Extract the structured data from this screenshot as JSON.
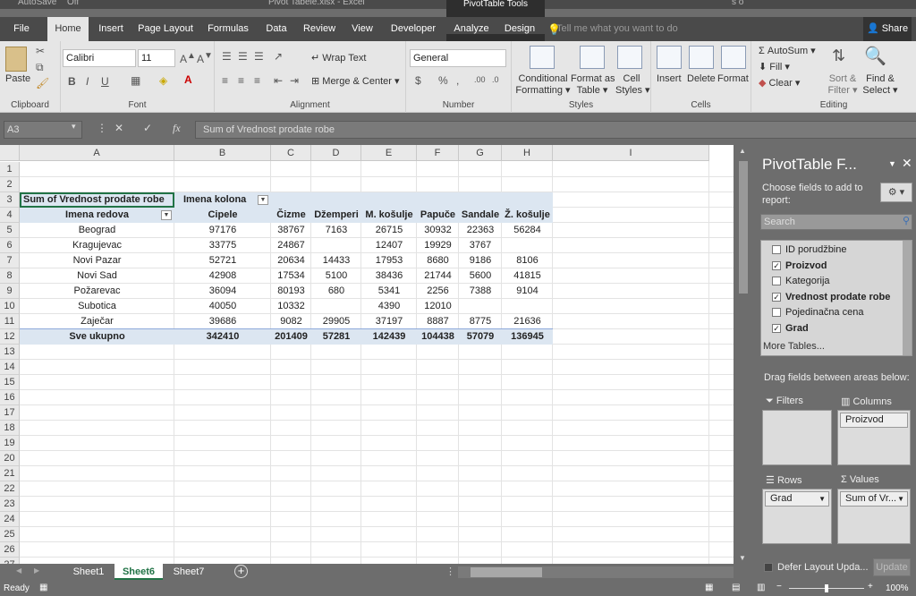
{
  "title_bar": {
    "autosave": "AutoSave",
    "autosave_state": "Off",
    "filename": "Pivot Tabele.xlsx - Excel",
    "user": "s o"
  },
  "context_header": "PivotTable Tools",
  "tabs": [
    "File",
    "Home",
    "Insert",
    "Page Layout",
    "Formulas",
    "Data",
    "Review",
    "View",
    "Developer",
    "Analyze",
    "Design"
  ],
  "active_tab": "Home",
  "tell_me": "Tell me what you want to do",
  "share": "Share",
  "ribbon": {
    "clipboard": {
      "paste": "Paste",
      "label": "Clipboard"
    },
    "font": {
      "name": "Calibri",
      "size": "11",
      "label": "Font",
      "bold": "B",
      "italic": "I",
      "underline": "U"
    },
    "alignment": {
      "wrap": "Wrap Text",
      "merge": "Merge & Center",
      "label": "Alignment"
    },
    "number": {
      "format": "General",
      "currency": "$",
      "percent": "%",
      "comma": ",",
      "label": "Number"
    },
    "styles": {
      "cond": "Conditional",
      "cond2": "Formatting",
      "fat": "Format as",
      "fat2": "Table",
      "cell": "Cell",
      "cell2": "Styles",
      "label": "Styles"
    },
    "cells": {
      "insert": "Insert",
      "delete": "Delete",
      "format": "Format",
      "label": "Cells"
    },
    "editing": {
      "autosum": "AutoSum",
      "fill": "Fill",
      "clear": "Clear",
      "sort": "Sort &",
      "sort2": "Filter",
      "find": "Find &",
      "find2": "Select",
      "label": "Editing"
    }
  },
  "formula_bar": {
    "name_box": "A3",
    "fx": "fx",
    "content": "Sum of Vrednost prodate robe"
  },
  "columns": [
    "A",
    "B",
    "C",
    "D",
    "E",
    "F",
    "G",
    "H",
    "I"
  ],
  "rows": [
    "1",
    "2",
    "3",
    "4",
    "5",
    "6",
    "7",
    "8",
    "9",
    "10",
    "11",
    "12",
    "13",
    "14",
    "15",
    "16",
    "17",
    "18",
    "19",
    "20",
    "21",
    "22",
    "23",
    "24",
    "25",
    "26",
    "27"
  ],
  "pivot": {
    "values_label": "Sum of Vrednost prodate robe",
    "col_labels": "Imena kolona",
    "row_labels": "Imena redova",
    "products": [
      "Cipele",
      "Čizme",
      "Džemperi",
      "M. košulje",
      "Papuče",
      "Sandale",
      "Ž. košulje"
    ],
    "data": [
      {
        "city": "Beograd",
        "vals": [
          "97176",
          "38767",
          "7163",
          "26715",
          "30932",
          "22363",
          "56284"
        ]
      },
      {
        "city": "Kragujevac",
        "vals": [
          "33775",
          "24867",
          "",
          "12407",
          "19929",
          "3767",
          ""
        ]
      },
      {
        "city": "Novi Pazar",
        "vals": [
          "52721",
          "20634",
          "14433",
          "17953",
          "8680",
          "9186",
          "8106"
        ]
      },
      {
        "city": "Novi Sad",
        "vals": [
          "42908",
          "17534",
          "5100",
          "38436",
          "21744",
          "5600",
          "41815"
        ]
      },
      {
        "city": "Požarevac",
        "vals": [
          "36094",
          "80193",
          "680",
          "5341",
          "2256",
          "7388",
          "9104"
        ]
      },
      {
        "city": "Subotica",
        "vals": [
          "40050",
          "10332",
          "",
          "4390",
          "12010",
          "",
          ""
        ]
      },
      {
        "city": "Zaječar",
        "vals": [
          "39686",
          "9082",
          "29905",
          "37197",
          "8887",
          "8775",
          "21636"
        ]
      }
    ],
    "total_label": "Sve ukupno",
    "totals": [
      "342410",
      "201409",
      "57281",
      "142439",
      "104438",
      "57079",
      "136945"
    ]
  },
  "sheets": [
    "Sheet1",
    "Sheet6",
    "Sheet7"
  ],
  "active_sheet": "Sheet6",
  "status": {
    "ready": "Ready",
    "zoom": "100%"
  },
  "pivot_pane": {
    "title": "PivotTable F...",
    "subtitle": "Choose fields to add to report:",
    "search_placeholder": "Search",
    "fields": [
      {
        "name": "ID porudžbine",
        "checked": false
      },
      {
        "name": "Proizvod",
        "checked": true
      },
      {
        "name": "Kategorija",
        "checked": false
      },
      {
        "name": "Vrednost prodate robe",
        "checked": true
      },
      {
        "name": "Pojedinačna cena",
        "checked": false
      },
      {
        "name": "Grad",
        "checked": true
      }
    ],
    "more_tables": "More Tables...",
    "drag_label": "Drag fields between areas below:",
    "filters": "Filters",
    "columns": "Columns",
    "rows": "Rows",
    "values": "Values",
    "columns_item": "Proizvod",
    "rows_item": "Grad",
    "values_item": "Sum of Vr...",
    "defer": "Defer Layout Upda...",
    "update": "Update"
  }
}
